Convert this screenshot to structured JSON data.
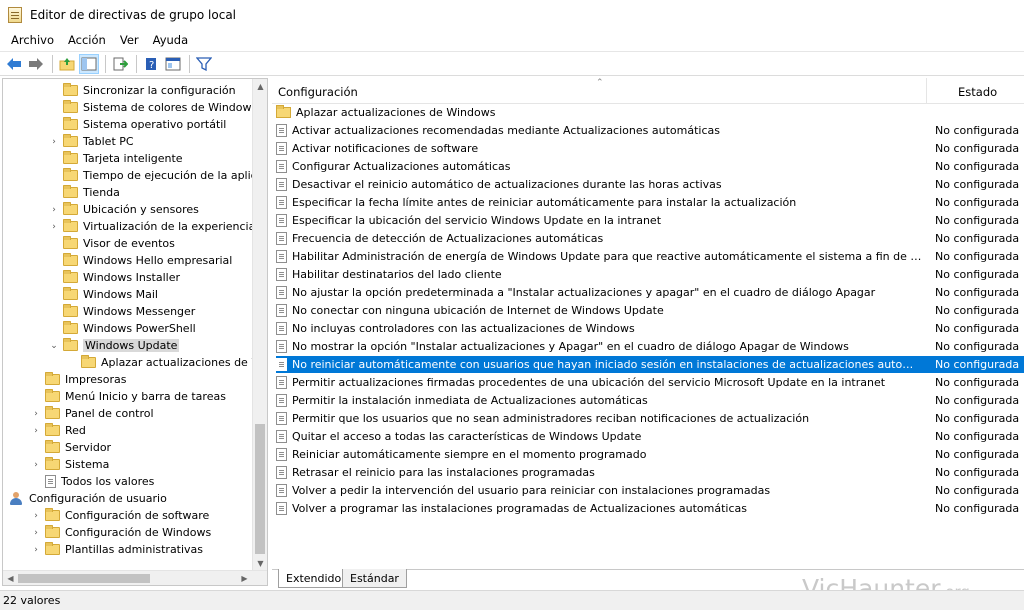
{
  "window": {
    "title": "Editor de directivas de grupo local"
  },
  "menu": [
    "Archivo",
    "Acción",
    "Ver",
    "Ayuda"
  ],
  "tree": [
    {
      "label": "Sincronizar la configuración",
      "indent": 2,
      "chevron": ""
    },
    {
      "label": "Sistema de colores de Windows",
      "indent": 2,
      "chevron": ""
    },
    {
      "label": "Sistema operativo portátil",
      "indent": 2,
      "chevron": ""
    },
    {
      "label": "Tablet PC",
      "indent": 2,
      "chevron": ">"
    },
    {
      "label": "Tarjeta inteligente",
      "indent": 2,
      "chevron": ""
    },
    {
      "label": "Tiempo de ejecución de la aplic",
      "indent": 2,
      "chevron": ""
    },
    {
      "label": "Tienda",
      "indent": 2,
      "chevron": ""
    },
    {
      "label": "Ubicación y sensores",
      "indent": 2,
      "chevron": ">"
    },
    {
      "label": "Virtualización de la experiencia",
      "indent": 2,
      "chevron": ">"
    },
    {
      "label": "Visor de eventos",
      "indent": 2,
      "chevron": ""
    },
    {
      "label": "Windows Hello empresarial",
      "indent": 2,
      "chevron": ""
    },
    {
      "label": "Windows Installer",
      "indent": 2,
      "chevron": ""
    },
    {
      "label": "Windows Mail",
      "indent": 2,
      "chevron": ""
    },
    {
      "label": "Windows Messenger",
      "indent": 2,
      "chevron": ""
    },
    {
      "label": "Windows PowerShell",
      "indent": 2,
      "chevron": ""
    },
    {
      "label": "Windows Update",
      "indent": 2,
      "chevron": "v",
      "selected": true
    },
    {
      "label": "Aplazar actualizaciones de W",
      "indent": 3,
      "chevron": ""
    },
    {
      "label": "Impresoras",
      "indent": 1,
      "chevron": ""
    },
    {
      "label": "Menú Inicio y barra de tareas",
      "indent": 1,
      "chevron": ""
    },
    {
      "label": "Panel de control",
      "indent": 1,
      "chevron": ">"
    },
    {
      "label": "Red",
      "indent": 1,
      "chevron": ">"
    },
    {
      "label": "Servidor",
      "indent": 1,
      "chevron": ""
    },
    {
      "label": "Sistema",
      "indent": 1,
      "chevron": ">"
    },
    {
      "label": "Todos los valores",
      "indent": 1,
      "chevron": "",
      "icon": "doc"
    },
    {
      "label": "Configuración de usuario",
      "indent": 0,
      "chevron": "v",
      "icon": "user"
    },
    {
      "label": "Configuración de software",
      "indent": 0.5,
      "chevron": ">"
    },
    {
      "label": "Configuración de Windows",
      "indent": 0.5,
      "chevron": ">"
    },
    {
      "label": "Plantillas administrativas",
      "indent": 0.5,
      "chevron": ">"
    }
  ],
  "columns": {
    "config": "Configuración",
    "state": "Estado"
  },
  "policies": [
    {
      "name": "Aplazar actualizaciones de Windows",
      "state": "",
      "icon": "folder"
    },
    {
      "name": "Activar actualizaciones recomendadas mediante Actualizaciones automáticas",
      "state": "No configurada"
    },
    {
      "name": "Activar notificaciones de software",
      "state": "No configurada"
    },
    {
      "name": "Configurar Actualizaciones automáticas",
      "state": "No configurada"
    },
    {
      "name": "Desactivar el reinicio automático de actualizaciones durante las horas activas",
      "state": "No configurada"
    },
    {
      "name": "Especificar la fecha límite antes de reiniciar automáticamente para instalar la actualización",
      "state": "No configurada"
    },
    {
      "name": "Especificar la ubicación del servicio Windows Update en la intranet",
      "state": "No configurada"
    },
    {
      "name": "Frecuencia de detección de Actualizaciones automáticas",
      "state": "No configurada"
    },
    {
      "name": "Habilitar Administración de energía de Windows Update para que reactive automáticamente el sistema a fin de instalar actu...",
      "state": "No configurada"
    },
    {
      "name": "Habilitar destinatarios del lado cliente",
      "state": "No configurada"
    },
    {
      "name": "No ajustar la opción predeterminada a \"Instalar actualizaciones y apagar\" en el cuadro de diálogo Apagar",
      "state": "No configurada"
    },
    {
      "name": "No conectar con ninguna ubicación de Internet de Windows Update",
      "state": "No configurada"
    },
    {
      "name": "No incluyas controladores con las actualizaciones de Windows",
      "state": "No configurada"
    },
    {
      "name": "No mostrar la opción \"Instalar actualizaciones y Apagar\" en el cuadro de diálogo Apagar de Windows",
      "state": "No configurada"
    },
    {
      "name": "No reiniciar automáticamente con usuarios que hayan iniciado sesión en instalaciones de actualizaciones automáticas",
      "state": "No configurada",
      "selected": true
    },
    {
      "name": "Permitir actualizaciones firmadas procedentes de una ubicación del servicio Microsoft Update en la intranet",
      "state": "No configurada"
    },
    {
      "name": "Permitir la instalación inmediata de Actualizaciones automáticas",
      "state": "No configurada"
    },
    {
      "name": "Permitir que los usuarios que no sean administradores reciban notificaciones de actualización",
      "state": "No configurada"
    },
    {
      "name": "Quitar el acceso a todas las características de Windows Update",
      "state": "No configurada"
    },
    {
      "name": "Reiniciar automáticamente siempre en el momento programado",
      "state": "No configurada"
    },
    {
      "name": "Retrasar el reinicio para las instalaciones programadas",
      "state": "No configurada"
    },
    {
      "name": "Volver a pedir la intervención del usuario para reiniciar con instalaciones programadas",
      "state": "No configurada"
    },
    {
      "name": "Volver a programar las instalaciones programadas de Actualizaciones automáticas",
      "state": "No configurada"
    }
  ],
  "tabs": [
    "Extendido",
    "Estándar"
  ],
  "status": "22 valores",
  "watermark": {
    "main": "VicHaunter",
    "tld": ".org"
  },
  "colors": {
    "selection": "#0078d7",
    "tree_selection": "#d9d9d9",
    "folder": "#f7d774"
  }
}
